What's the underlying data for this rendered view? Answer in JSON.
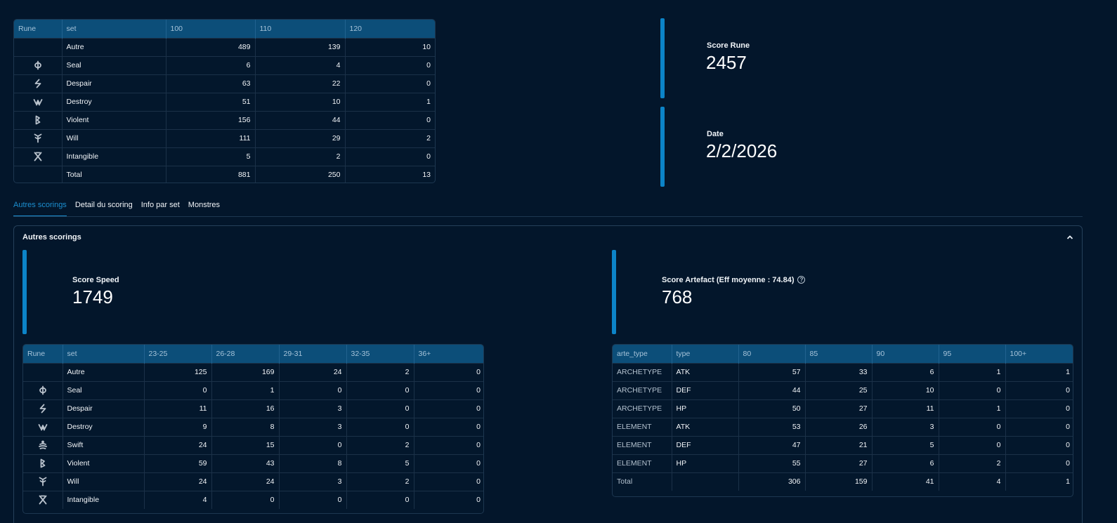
{
  "top_table": {
    "headers": [
      "Rune",
      "set",
      "100",
      "110",
      "120"
    ],
    "rows": [
      {
        "icon": "",
        "set": "Autre",
        "v": [
          "489",
          "139",
          "10"
        ]
      },
      {
        "icon": "seal",
        "set": "Seal",
        "v": [
          "6",
          "4",
          "0"
        ]
      },
      {
        "icon": "despair",
        "set": "Despair",
        "v": [
          "63",
          "22",
          "0"
        ]
      },
      {
        "icon": "destroy",
        "set": "Destroy",
        "v": [
          "51",
          "10",
          "1"
        ]
      },
      {
        "icon": "violent",
        "set": "Violent",
        "v": [
          "156",
          "44",
          "0"
        ]
      },
      {
        "icon": "will",
        "set": "Will",
        "v": [
          "111",
          "29",
          "2"
        ]
      },
      {
        "icon": "intangible",
        "set": "Intangible",
        "v": [
          "5",
          "2",
          "0"
        ]
      },
      {
        "icon": "",
        "set": "Total",
        "v": [
          "881",
          "250",
          "13"
        ]
      }
    ]
  },
  "score_rune": {
    "label": "Score Rune",
    "value": "2457"
  },
  "date": {
    "label": "Date",
    "value": "2/2/2026"
  },
  "tabs": [
    {
      "label": "Autres scorings",
      "active": true
    },
    {
      "label": "Detail du scoring",
      "active": false
    },
    {
      "label": "Info par set",
      "active": false
    },
    {
      "label": "Monstres",
      "active": false
    }
  ],
  "panel": {
    "title": "Autres scorings"
  },
  "score_speed": {
    "label": "Score Speed",
    "value": "1749"
  },
  "score_artefact": {
    "label": "Score Artefact (Eff moyenne : 74.84)",
    "value": "768",
    "help": "?"
  },
  "speed_table": {
    "headers": [
      "Rune",
      "set",
      "23-25",
      "26-28",
      "29-31",
      "32-35",
      "36+"
    ],
    "rows": [
      {
        "icon": "",
        "set": "Autre",
        "v": [
          "125",
          "169",
          "24",
          "2",
          "0"
        ]
      },
      {
        "icon": "seal",
        "set": "Seal",
        "v": [
          "0",
          "1",
          "0",
          "0",
          "0"
        ]
      },
      {
        "icon": "despair",
        "set": "Despair",
        "v": [
          "11",
          "16",
          "3",
          "0",
          "0"
        ]
      },
      {
        "icon": "destroy",
        "set": "Destroy",
        "v": [
          "9",
          "8",
          "3",
          "0",
          "0"
        ]
      },
      {
        "icon": "swift",
        "set": "Swift",
        "v": [
          "24",
          "15",
          "0",
          "2",
          "0"
        ]
      },
      {
        "icon": "violent",
        "set": "Violent",
        "v": [
          "59",
          "43",
          "8",
          "5",
          "0"
        ]
      },
      {
        "icon": "will",
        "set": "Will",
        "v": [
          "24",
          "24",
          "3",
          "2",
          "0"
        ]
      },
      {
        "icon": "intangible",
        "set": "Intangible",
        "v": [
          "4",
          "0",
          "0",
          "0",
          "0"
        ]
      }
    ]
  },
  "arte_table": {
    "headers": [
      "arte_type",
      "type",
      "80",
      "85",
      "90",
      "95",
      "100+"
    ],
    "rows": [
      {
        "arte_type": "ARCHETYPE",
        "type": "ATK",
        "v": [
          "57",
          "33",
          "6",
          "1",
          "1"
        ]
      },
      {
        "arte_type": "ARCHETYPE",
        "type": "DEF",
        "v": [
          "44",
          "25",
          "10",
          "0",
          "0"
        ]
      },
      {
        "arte_type": "ARCHETYPE",
        "type": "HP",
        "v": [
          "50",
          "27",
          "11",
          "1",
          "0"
        ]
      },
      {
        "arte_type": "ELEMENT",
        "type": "ATK",
        "v": [
          "53",
          "26",
          "3",
          "0",
          "0"
        ]
      },
      {
        "arte_type": "ELEMENT",
        "type": "DEF",
        "v": [
          "47",
          "21",
          "5",
          "0",
          "0"
        ]
      },
      {
        "arte_type": "ELEMENT",
        "type": "HP",
        "v": [
          "55",
          "27",
          "6",
          "2",
          "0"
        ]
      },
      {
        "arte_type": "Total",
        "type": "",
        "v": [
          "306",
          "159",
          "41",
          "4",
          "1"
        ]
      }
    ]
  },
  "colors": {
    "background": "#03162b",
    "header": "#0c4e79",
    "accent": "#0c84c8",
    "tab_active": "#1c8fd0"
  }
}
